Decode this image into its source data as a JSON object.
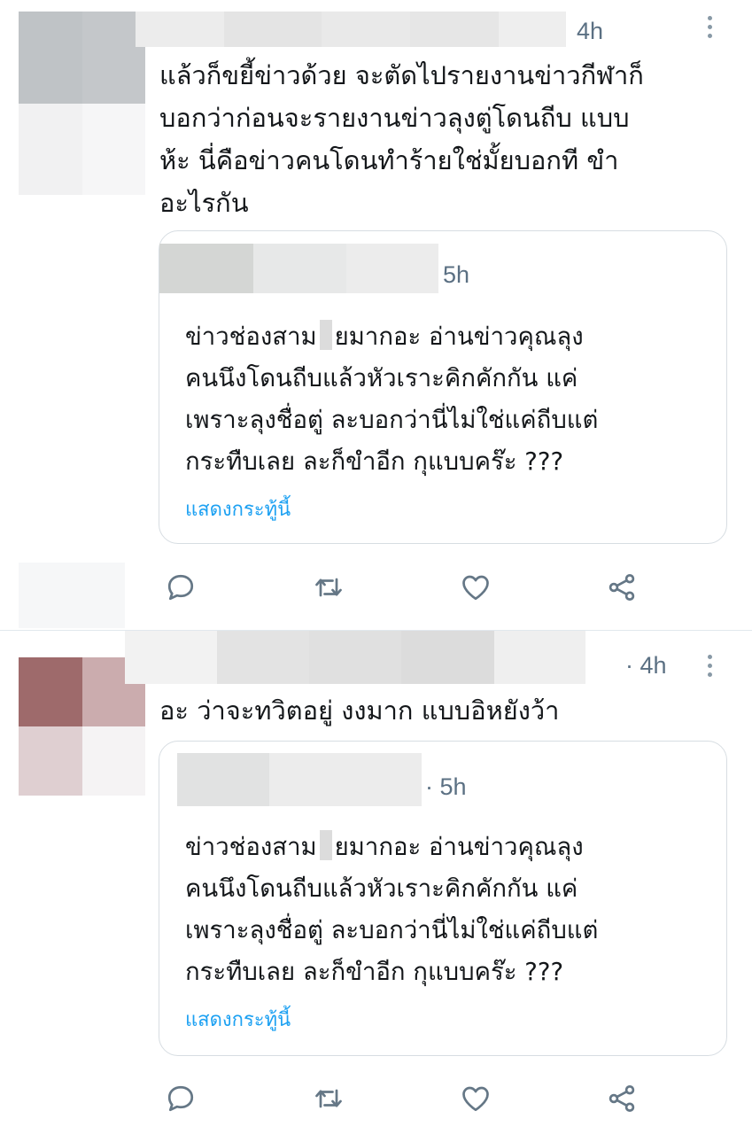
{
  "tweets": [
    {
      "time": "4h",
      "text_lines": [
        "แล้วก็ขยี้ข่าวด้วย จะตัดไปรายงานข่าวกีฬาก็",
        "บอกว่าก่อนจะรายงานข่าวลุงตู่โดนถีบ แบบ",
        "ห้ะ นี่คือข่าวคนโดนทำร้ายใช่มั้ยบอกที ขำ",
        "อะไรกัน"
      ],
      "quote": {
        "time": "5h",
        "line1_a": "ข่าวช่องสาม",
        "line1_b": "ยมากอะ อ่านข่าวคุณลุง",
        "line2": "คนนึงโดนถีบแล้วหัวเราะคิกคักกัน แค่",
        "line3": "เพราะลุงชื่อตู่ ละบอกว่านี่ไม่ใช่แค่ถีบแต่",
        "line4": "กระทืบเลย ละก็ขำอีก กุแบบคร๊ะ ???",
        "show_thread": "แสดงกระทู้นี้"
      }
    },
    {
      "time": "· 4h",
      "text_lines": [
        "อะ ว่าจะทวิตอยู่ งงมาก แบบอิหยังว้า"
      ],
      "quote": {
        "time": "· 5h",
        "line1_a": "ข่าวช่องสาม",
        "line1_b": "ยมากอะ อ่านข่าวคุณลุง",
        "line2": "คนนึงโดนถีบแล้วหัวเราะคิกคักกัน แค่",
        "line3": "เพราะลุงชื่อตู่ ละบอกว่านี่ไม่ใช่แค่ถีบแต่",
        "line4": "กระทืบเลย ละก็ขำอีก กุแบบคร๊ะ ???",
        "show_thread": "แสดงกระทู้นี้"
      }
    }
  ],
  "icons": {
    "reply": "reply-icon",
    "retweet": "retweet-icon",
    "like": "heart-icon",
    "share": "share-icon",
    "more": "more-vertical-icon"
  },
  "colors": {
    "link": "#1da1f2",
    "meta": "#5b7083",
    "icon": "#657786",
    "border": "#d7dde2"
  }
}
